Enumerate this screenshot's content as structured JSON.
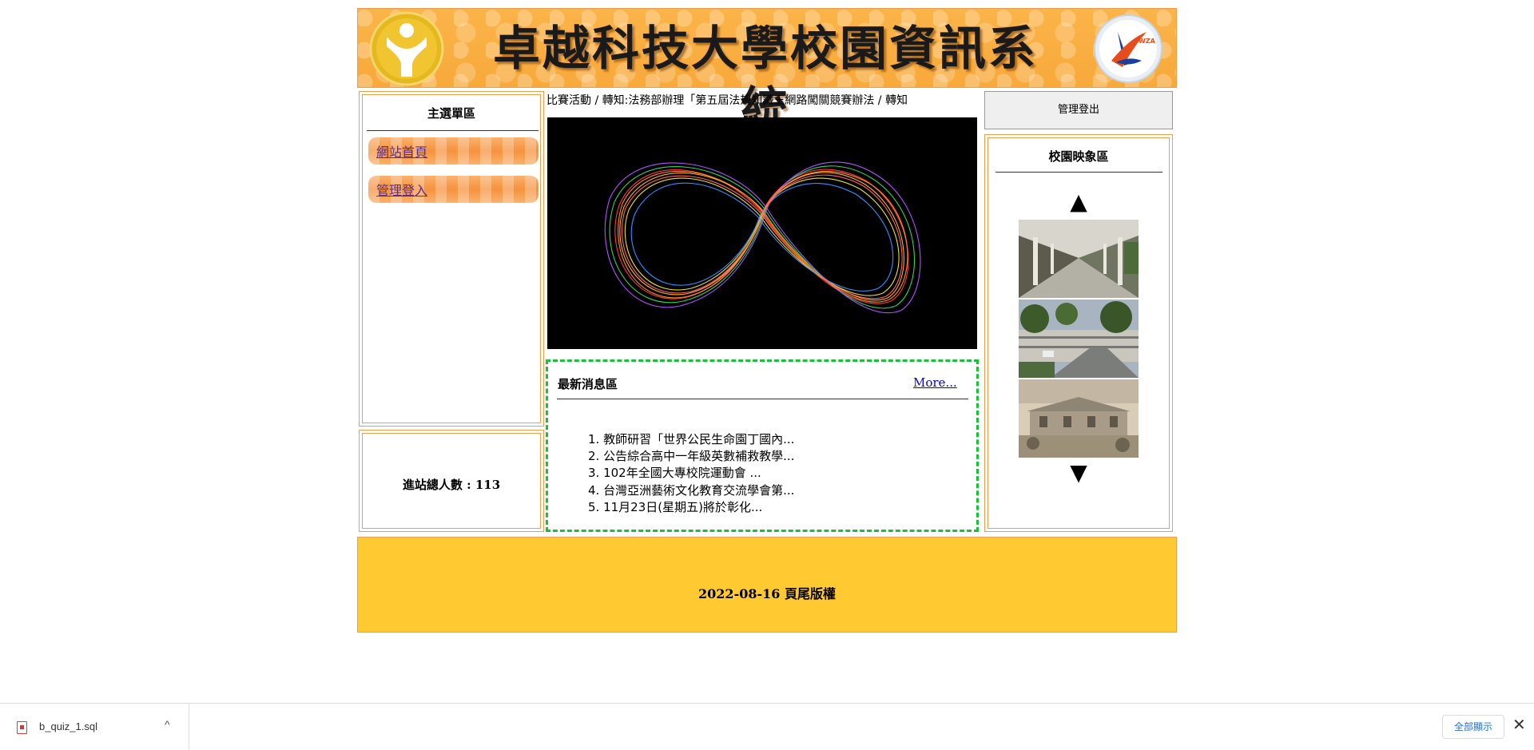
{
  "header": {
    "title": "卓越科技大學校園資訊系統",
    "logo_left_icon": "school-emblem-icon",
    "logo_right_icon": "anniversary-logo-icon",
    "logo_right_text": "WZA"
  },
  "menu": {
    "title": "主選單區",
    "items": [
      {
        "label": "網站首頁"
      },
      {
        "label": "管理登入"
      }
    ]
  },
  "counter": {
    "text": "進站總人數 : 113"
  },
  "marquee": {
    "text": "書法比賽活動 / 轉知:法務部辦理「第五屆法規知識王網路闖關競賽辦法 / 轉知"
  },
  "news": {
    "title": "最新消息區",
    "more_label": "More...",
    "items": [
      "1. 教師研習「世界公民生命園丁國內...",
      "2. 公告綜合高中一年級英數補救教學...",
      "3. 102年全國大專校院運動會 ...",
      "4. 台灣亞洲藝術文化教育交流學會第...",
      "5. 11月23日(星期五)將於彰化..."
    ]
  },
  "logout": {
    "label": "管理登出"
  },
  "gallery": {
    "title": "校園映象區",
    "up_arrow": "▲",
    "down_arrow": "▼"
  },
  "footer": {
    "text": "2022-08-16 頁尾版權"
  },
  "download_bar": {
    "file_name": "b_quiz_1.sql",
    "chevron": "^",
    "show_all_label": "全部顯示",
    "close_glyph": "✕"
  },
  "colors": {
    "header_bg": "#f8a93a",
    "frame_border": "#e8a050",
    "footer_bg": "#ffc932",
    "news_border": "#19c03c",
    "link": "#0000ee"
  }
}
